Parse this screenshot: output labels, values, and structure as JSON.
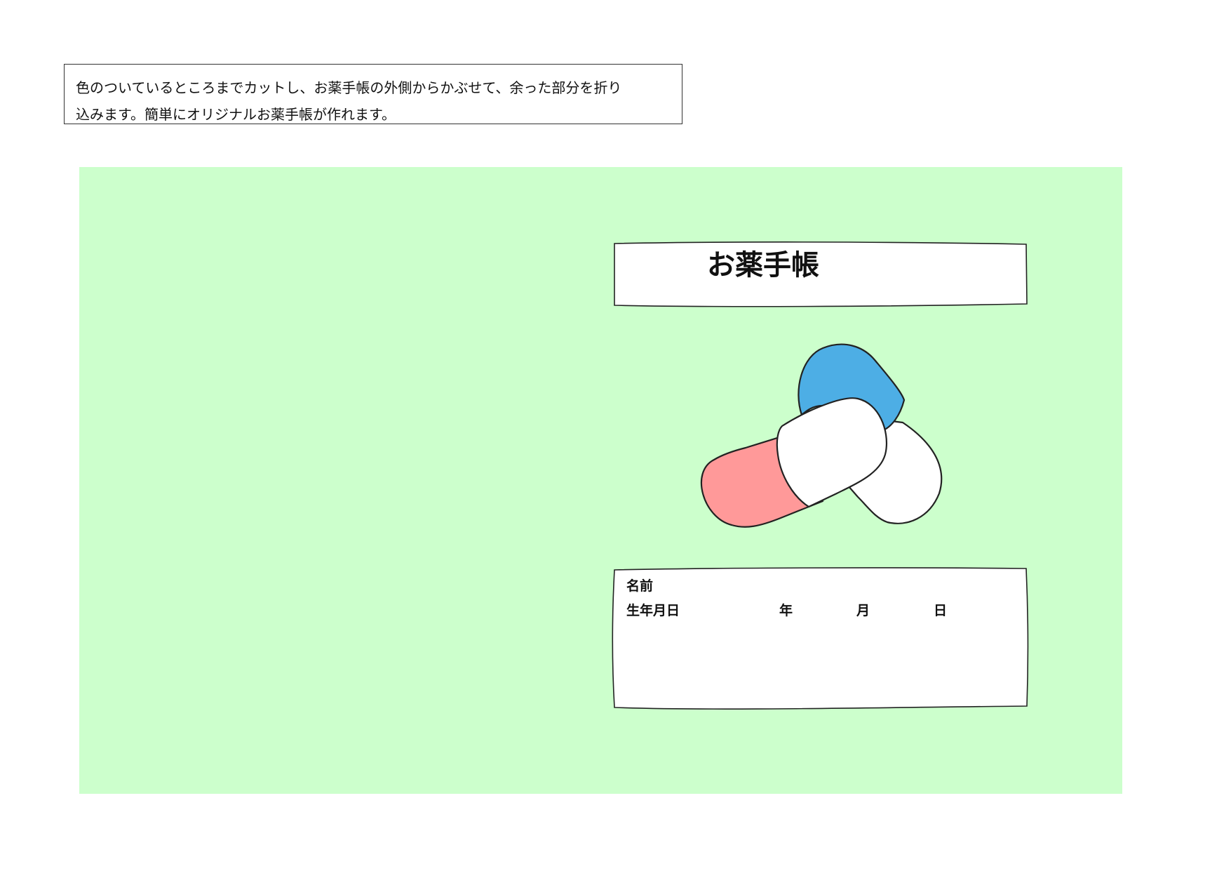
{
  "instructions": {
    "line1": "色のついているところまでカットし、お薬手帳の外側からかぶせて、余った部分を折り",
    "line2": "込みます。簡単にオリジナルお薬手帳が作れます。"
  },
  "cover": {
    "background_color": "#ccffcc",
    "title": "お薬手帳",
    "illustration": {
      "icon": "capsule-pills-icon",
      "colors": {
        "blue_cap": "#4daee5",
        "red_cap": "#ff9999",
        "white_body": "#ffffff",
        "outline": "#222222"
      }
    },
    "info": {
      "name_label": "名前",
      "birthdate_label": "生年月日",
      "year_label": "年",
      "month_label": "月",
      "day_label": "日"
    }
  }
}
